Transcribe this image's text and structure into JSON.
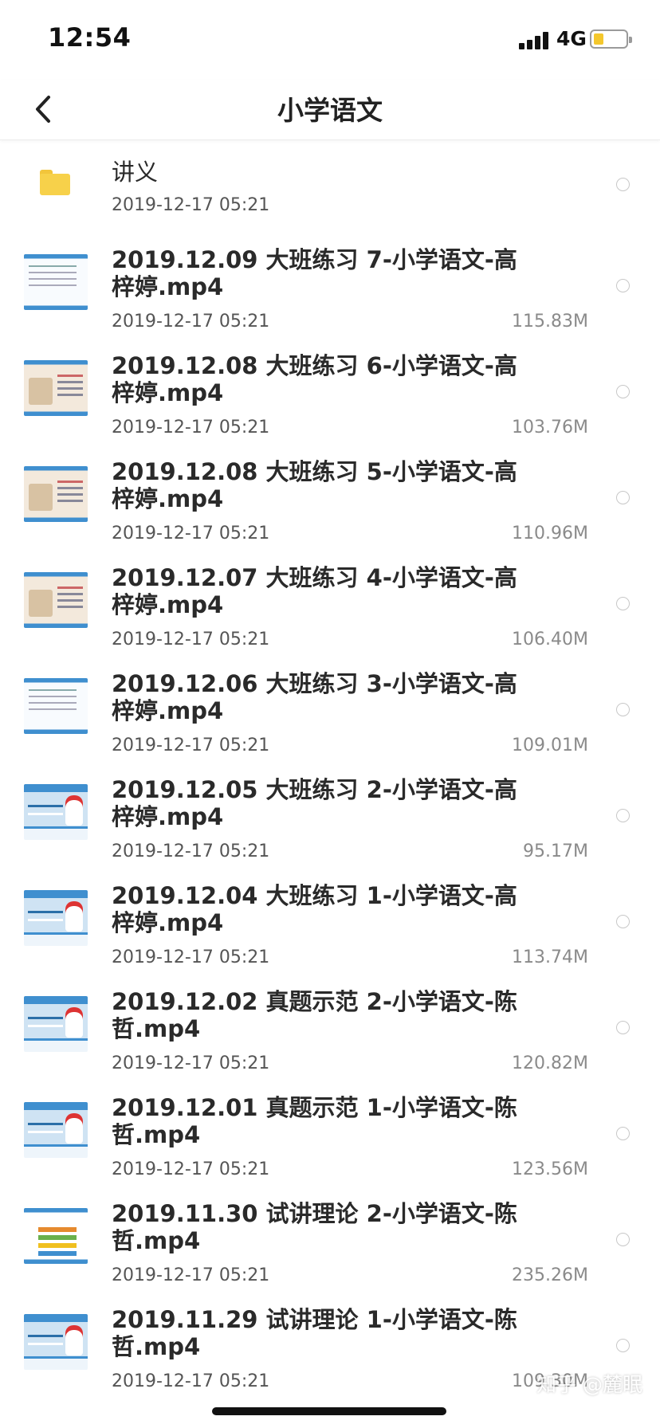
{
  "status_bar": {
    "time": "12:54",
    "network": "4G",
    "battery_level": 0.3,
    "battery_color": "#f4c72c"
  },
  "nav": {
    "back_icon": "chevron-left-icon",
    "title": "小学语文"
  },
  "files": [
    {
      "type": "folder",
      "name": "讲义",
      "date": "2019-12-17 05:21",
      "size": ""
    },
    {
      "type": "video",
      "thumb": "white",
      "name": "2019.12.09 大班练习 7-小学语文-高梓婷.mp4",
      "date": "2019-12-17 05:21",
      "size": "115.83M"
    },
    {
      "type": "video",
      "thumb": "cream",
      "name": "2019.12.08 大班练习 6-小学语文-高梓婷.mp4",
      "date": "2019-12-17 05:21",
      "size": "103.76M"
    },
    {
      "type": "video",
      "thumb": "cream",
      "name": "2019.12.08 大班练习 5-小学语文-高梓婷.mp4",
      "date": "2019-12-17 05:21",
      "size": "110.96M"
    },
    {
      "type": "video",
      "thumb": "cream",
      "name": "2019.12.07 大班练习 4-小学语文-高梓婷.mp4",
      "date": "2019-12-17 05:21",
      "size": "106.40M"
    },
    {
      "type": "video",
      "thumb": "white",
      "name": "2019.12.06 大班练习 3-小学语文-高梓婷.mp4",
      "date": "2019-12-17 05:21",
      "size": "109.01M"
    },
    {
      "type": "video",
      "thumb": "blue",
      "name": "2019.12.05 大班练习 2-小学语文-高梓婷.mp4",
      "date": "2019-12-17 05:21",
      "size": "95.17M"
    },
    {
      "type": "video",
      "thumb": "blue",
      "name": "2019.12.04 大班练习 1-小学语文-高梓婷.mp4",
      "date": "2019-12-17 05:21",
      "size": "113.74M"
    },
    {
      "type": "video",
      "thumb": "blue",
      "name": "2019.12.02 真题示范 2-小学语文-陈哲.mp4",
      "date": "2019-12-17 05:21",
      "size": "120.82M"
    },
    {
      "type": "video",
      "thumb": "blue",
      "name": "2019.12.01 真题示范 1-小学语文-陈哲.mp4",
      "date": "2019-12-17 05:21",
      "size": "123.56M"
    },
    {
      "type": "video",
      "thumb": "ppt",
      "name": "2019.11.30 试讲理论 2-小学语文-陈哲.mp4",
      "date": "2019-12-17 05:21",
      "size": "235.26M"
    },
    {
      "type": "video",
      "thumb": "blue",
      "name": "2019.11.29 试讲理论 1-小学语文-陈哲.mp4",
      "date": "2019-12-17 05:21",
      "size": "109.30M"
    }
  ],
  "watermark": "知乎 @麓眠"
}
